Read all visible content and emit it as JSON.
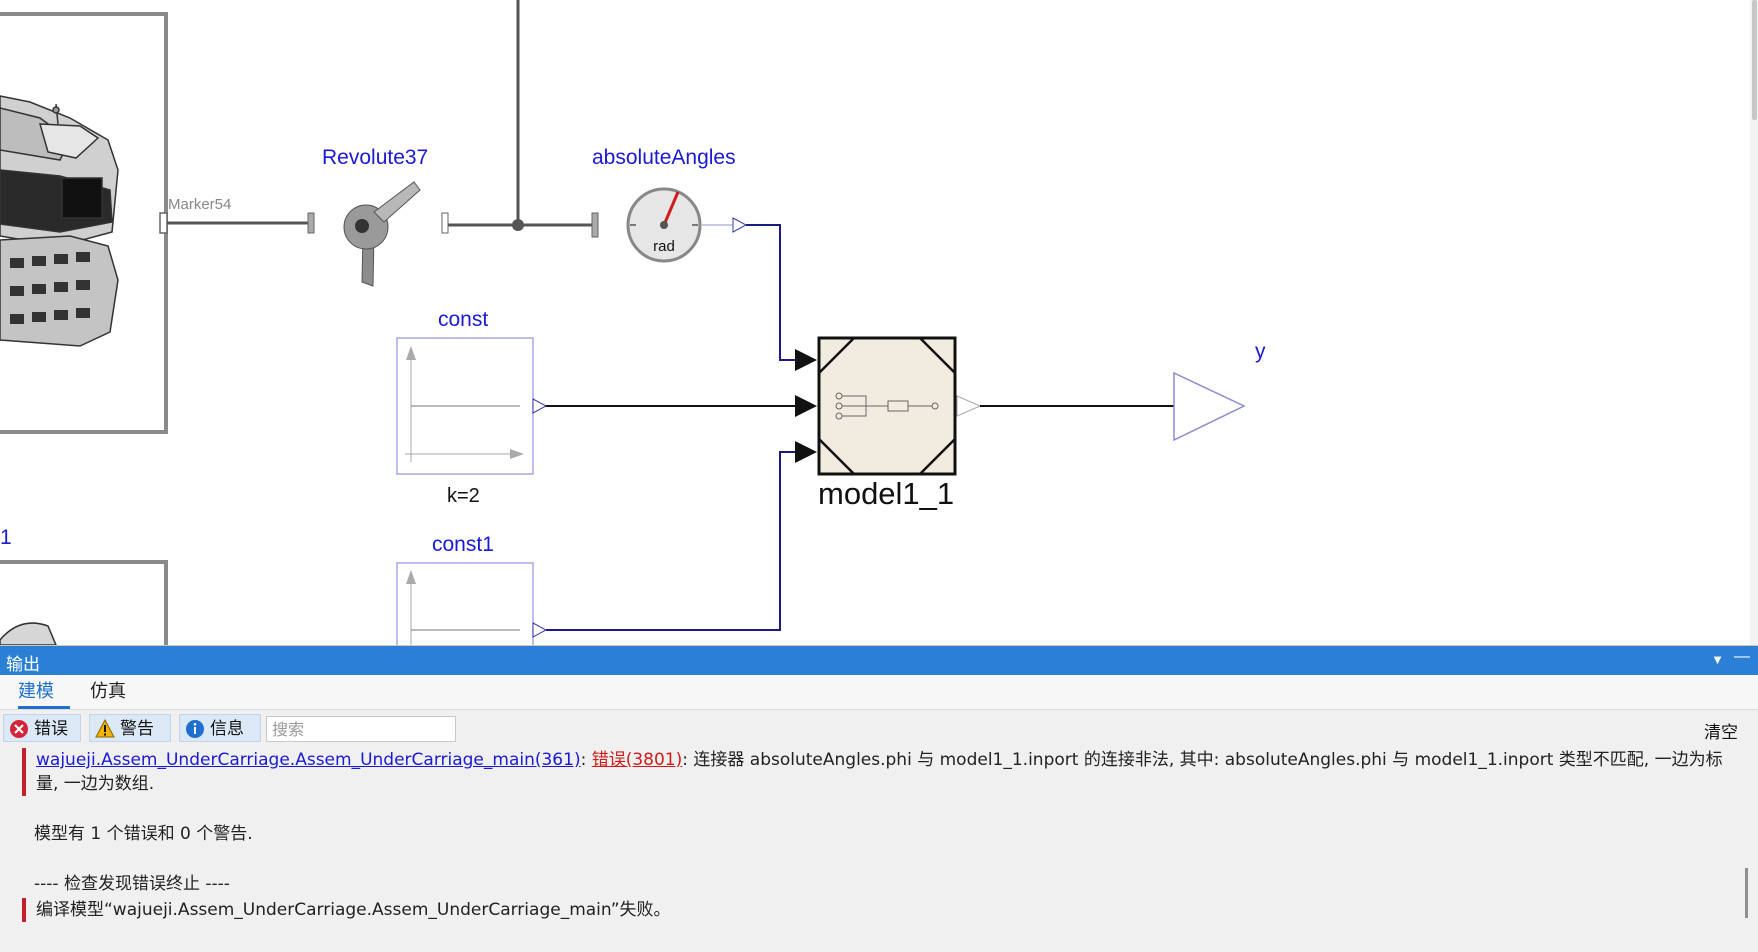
{
  "diagram": {
    "labels": {
      "marker": "Marker54",
      "revolute": "Revolute37",
      "absolute_angles": "absoluteAngles",
      "sensor_unit": "rad",
      "const": "const",
      "const_param": "k=2",
      "const1": "const1",
      "model": "model1_1",
      "output": "y",
      "left_fragment": "1"
    },
    "colors": {
      "label_blue": "#1a1ad6",
      "signal_line": "#1c1c80",
      "mechanical_line": "#444444",
      "model_fill": "#f2ece0"
    }
  },
  "panel": {
    "title": "输出",
    "controls": [
      "▼",
      "—"
    ],
    "tabs": [
      {
        "label": "建模",
        "active": true
      },
      {
        "label": "仿真",
        "active": false
      }
    ],
    "filters": {
      "error": "错误",
      "warning": "警告",
      "info": "信息"
    },
    "search_placeholder": "搜索",
    "clear": "清空"
  },
  "log": {
    "error_link": "wajueji.Assem_UnderCarriage.Assem_UnderCarriage_main(361)",
    "sep1": ": ",
    "error_code": "错误(3801)",
    "error_text": ": 连接器 absoluteAngles.phi 与 model1_1.inport 的连接非法, 其中: absoluteAngles.phi 与 model1_1.inport 类型不匹配, 一边为标量, 一边为数组.",
    "summary": "模型有 1 个错误和 0 个警告.",
    "stop": "---- 检查发现错误终止 ----",
    "compile_fail": "编译模型“wajueji.Assem_UnderCarriage.Assem_UnderCarriage_main”失败。"
  }
}
